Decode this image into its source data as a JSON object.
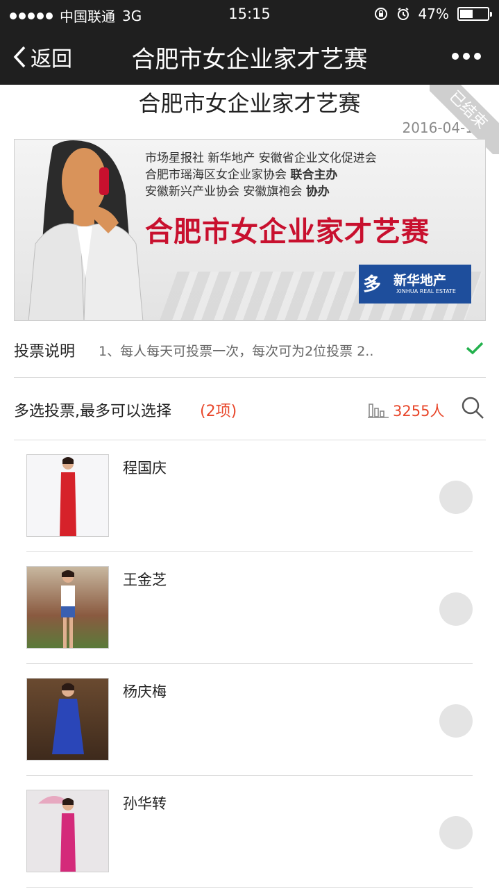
{
  "status_bar": {
    "carrier": "中国联通",
    "network": "3G",
    "time": "15:15",
    "battery": "47%",
    "battery_level": 0.47
  },
  "nav": {
    "back_label": "返回",
    "title": "合肥市女企业家才艺赛"
  },
  "page": {
    "title": "合肥市女企业家才艺赛",
    "date": "2016-04-1",
    "ribbon_text": "已结束"
  },
  "banner": {
    "org_line1": "市场星报社  新华地产  安徽省企业文化促进会",
    "org_line2_a": "合肥市瑶海区女企业家协会  ",
    "org_line2_b": "联合主办",
    "org_line3_a": "安徽新兴产业协会  安徽旗袍会  ",
    "org_line3_b": "协办",
    "headline": "合肥市女企业家才艺赛",
    "logo_cn": "新华地产",
    "logo_en": "XINHUA REAL ESTATE"
  },
  "vote_info": {
    "label": "投票说明",
    "text": "1、每人每天可投票一次，每次可为2位投票 2.."
  },
  "multi": {
    "label": "多选投票,最多可以选择",
    "limit": "(2项)",
    "count": "3255人"
  },
  "candidates": [
    {
      "name": "程国庆",
      "dress": "#d6222a"
    },
    {
      "name": "王金芝",
      "dress": "#3a5fb0"
    },
    {
      "name": "杨庆梅",
      "dress": "#2a46b8"
    },
    {
      "name": "孙华转",
      "dress": "#d42a7a"
    }
  ],
  "colors": {
    "accent": "#e8472b",
    "check": "#22b14c",
    "bar": "#1f1f1f"
  }
}
